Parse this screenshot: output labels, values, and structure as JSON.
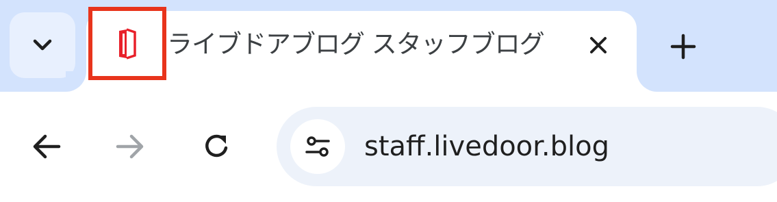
{
  "tab": {
    "title": "ライブドアブログ スタッフブログ",
    "favicon": "livedoor-blog-icon",
    "close_icon": "close-icon",
    "highlight_color": "#e8341c"
  },
  "tab_strip": {
    "tab_search_icon": "chevron-down-icon",
    "new_tab_icon": "plus-icon",
    "background_color": "#d3e3fd"
  },
  "toolbar": {
    "back_icon": "arrow-left-icon",
    "forward_icon": "arrow-right-icon",
    "reload_icon": "reload-icon",
    "site_info_icon": "tune-icon"
  },
  "omnibox": {
    "url": "staff.livedoor.blog"
  }
}
